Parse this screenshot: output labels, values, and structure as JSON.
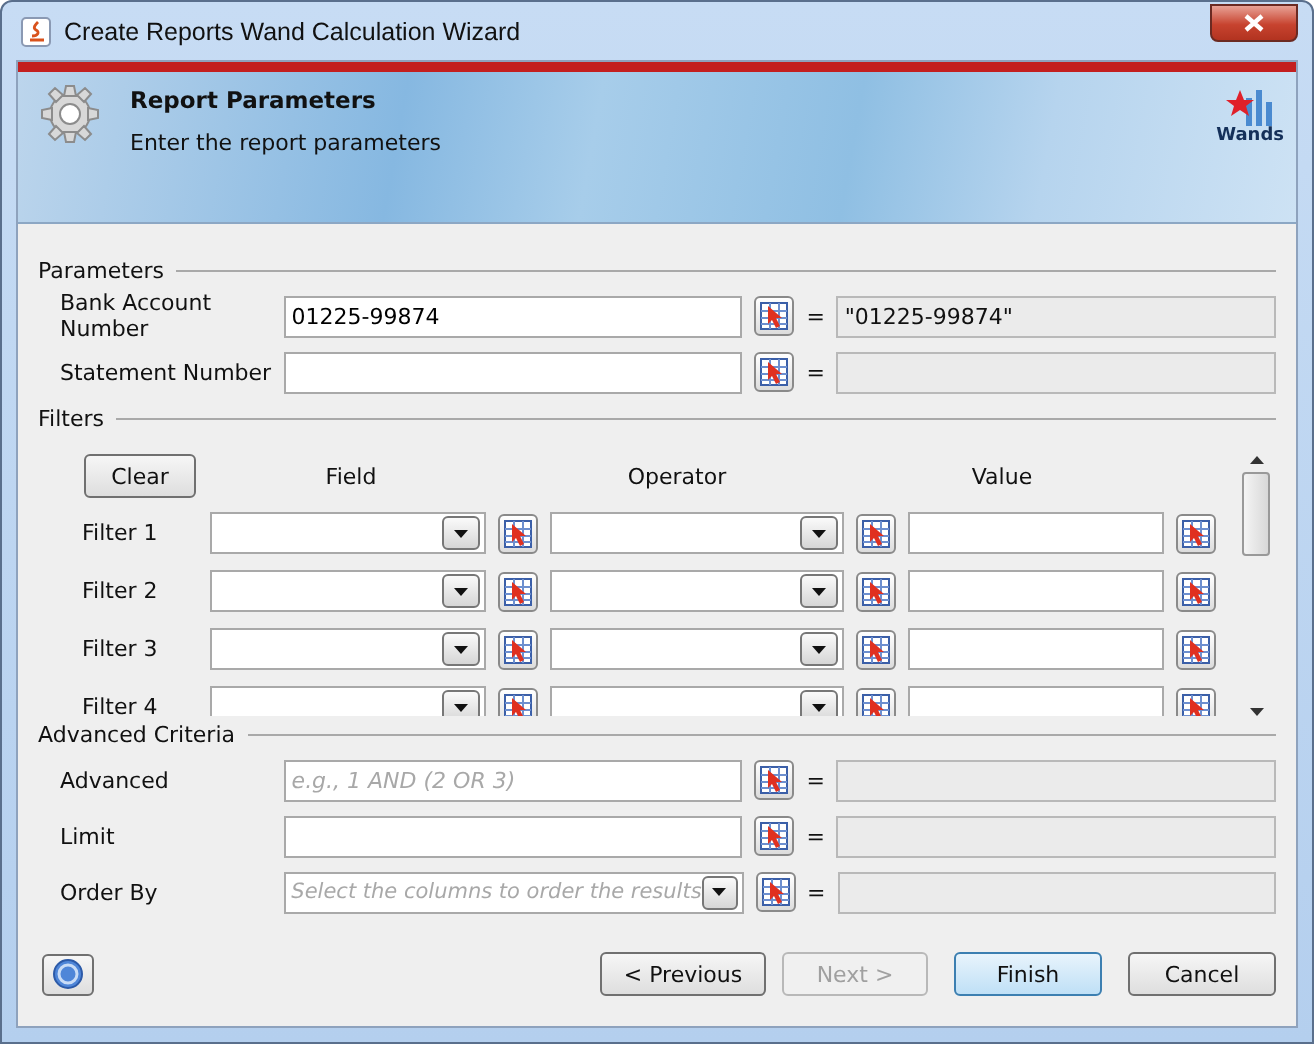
{
  "window": {
    "title": "Create Reports Wand Calculation Wizard"
  },
  "header": {
    "title": "Report Parameters",
    "subtitle": "Enter the report parameters",
    "logo_text": "Wands"
  },
  "parameters": {
    "heading": "Parameters",
    "rows": [
      {
        "label": "Bank Account Number",
        "value": "01225-99874",
        "equals": "=",
        "result": "\"01225-99874\""
      },
      {
        "label": "Statement Number",
        "equals": "="
      }
    ]
  },
  "filters": {
    "heading": "Filters",
    "clear_button": "Clear",
    "columns": [
      "Field",
      "Operator",
      "Value"
    ],
    "rows": [
      {
        "label": "Filter 1"
      },
      {
        "label": "Filter 2"
      },
      {
        "label": "Filter 3"
      },
      {
        "label": "Filter 4"
      }
    ]
  },
  "advanced_criteria": {
    "heading": "Advanced Criteria",
    "rows": [
      {
        "kind": "text",
        "label": "Advanced",
        "placeholder": "e.g., 1 AND (2 OR 3)",
        "equals": "="
      },
      {
        "kind": "text",
        "label": "Limit",
        "equals": "="
      },
      {
        "kind": "combo",
        "label": "Order By",
        "placeholder": "Select the columns to order the results",
        "equals": "="
      }
    ]
  },
  "buttons": [
    {
      "label": "< Previous",
      "disabled": false,
      "focused": false
    },
    {
      "label": "Next >",
      "disabled": true,
      "focused": false
    },
    {
      "label": "Finish",
      "disabled": false,
      "focused": true
    },
    {
      "label": "Cancel",
      "disabled": false,
      "focused": false
    }
  ]
}
